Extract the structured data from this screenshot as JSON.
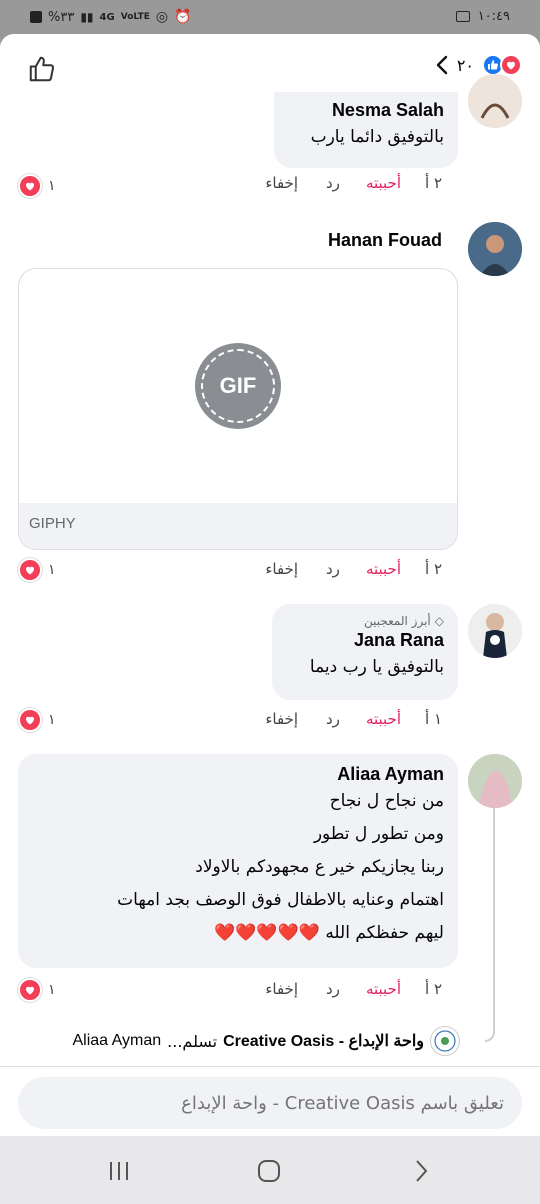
{
  "status_bar": {
    "time": "١٠:٤٩",
    "battery": "%٣٣",
    "network": "4G",
    "volte": "VoLTE"
  },
  "header": {
    "reaction_count": "٢٠"
  },
  "comments": [
    {
      "name": "Nesma Salah",
      "text": "بالتوفيق دائما يارب",
      "time": "٢ أ",
      "like": "أحببته",
      "reply": "رد",
      "hide": "إخفاء",
      "reactions": "١"
    },
    {
      "name": "Hanan Fouad",
      "gif_label": "GIF",
      "gif_source": "GIPHY",
      "time": "٢ أ",
      "like": "أحببته",
      "reply": "رد",
      "hide": "إخفاء",
      "reactions": "١"
    },
    {
      "badge": "أبرز المعجبين",
      "name": "Jana Rana",
      "text": "بالتوفيق يا رب ديما",
      "time": "١ أ",
      "like": "أحببته",
      "reply": "رد",
      "hide": "إخفاء",
      "reactions": "١"
    },
    {
      "name": "Aliaa Ayman",
      "lines": [
        "من نجاح ل نجاح",
        "ومن تطور ل تطور",
        "ربنا يجازيكم خير ع مجهودكم بالاولاد",
        "اهتمام وعنايه بالاطفال فوق الوصف بجد امهات",
        "ليهم حفظكم الله ❤️❤️❤️❤️❤️"
      ],
      "time": "٢ أ",
      "like": "أحببته",
      "reply": "رد",
      "hide": "إخفاء",
      "reactions": "١"
    }
  ],
  "reply_preview": {
    "page_name": "واحة الإبداع - Creative Oasis",
    "snippet": "تسلم...",
    "author": "Aliaa Ayman"
  },
  "composer": {
    "placeholder": "تعليق باسم Creative Oasis - واحة الإبداع"
  },
  "colors": {
    "like_blue": "#1877f2",
    "love_red": "#f33e58",
    "liked_text": "#e0245e",
    "bubble_bg": "#f0f2f5"
  }
}
